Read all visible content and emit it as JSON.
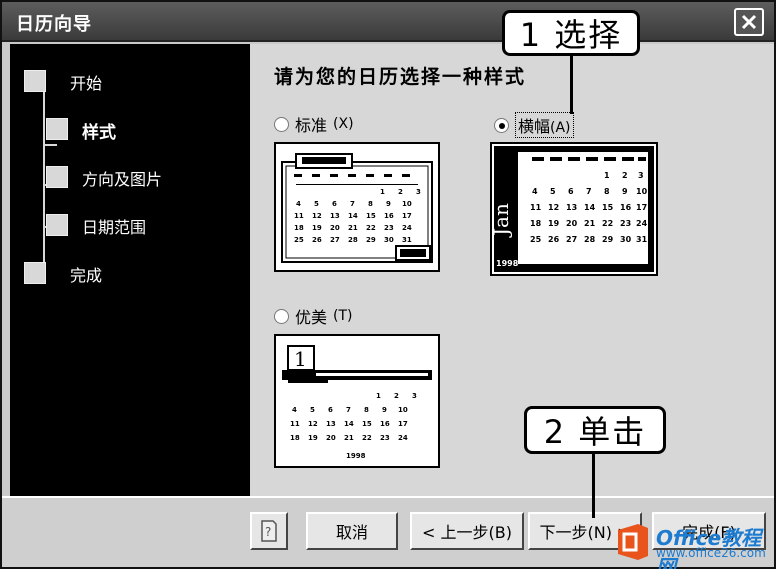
{
  "window": {
    "title": "日历向导",
    "close_icon": "close-icon"
  },
  "nav": {
    "items": [
      {
        "label": "开始",
        "active": false
      },
      {
        "label": "样式",
        "active": true
      },
      {
        "label": "方向及图片",
        "active": false
      },
      {
        "label": "日期范围",
        "active": false
      },
      {
        "label": "完成",
        "active": false
      }
    ]
  },
  "content": {
    "heading": "请为您的日历选择一种样式",
    "options": [
      {
        "label": "标准",
        "accel": "(X)",
        "selected": false
      },
      {
        "label": "横幅",
        "accel": "(A)",
        "selected": true
      },
      {
        "label": "优美",
        "accel": "(T)",
        "selected": false
      }
    ]
  },
  "buttons": {
    "help_icon": "help-icon",
    "cancel": "取消",
    "back": "< 上一步(B)",
    "next": "下一步(N) >",
    "finish": "完成(F)"
  },
  "callouts": {
    "first": "1 选择",
    "second": "2 单击"
  },
  "watermark": {
    "text": "Office教程网",
    "url": "www.office26.com"
  },
  "colors": {
    "titlebar": "#4a4a4a",
    "nav_bg": "#000000",
    "content_bg": "#d7d7d7",
    "watermark": "#1d7bd0",
    "watermark_logo": "#e8541c"
  }
}
